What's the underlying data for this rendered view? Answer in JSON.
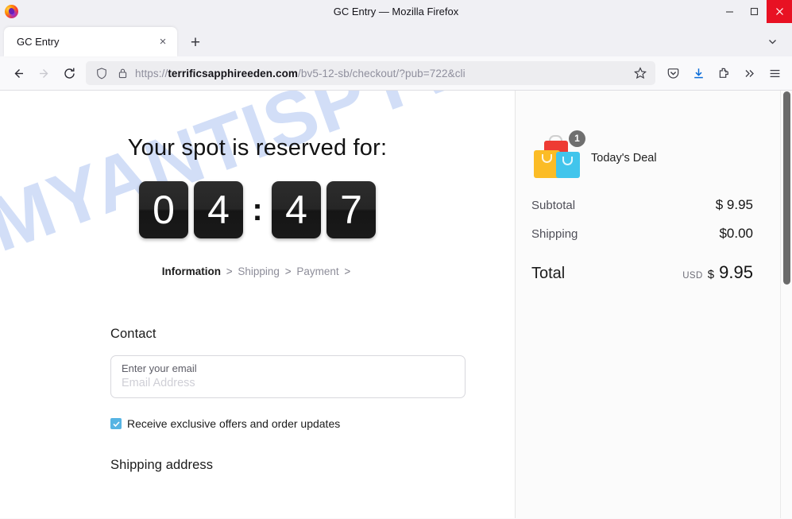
{
  "window": {
    "title": "GC Entry — Mozilla Firefox",
    "logo_icon": "firefox-logo",
    "minimize_label": "Minimize",
    "maximize_label": "Maximize",
    "close_label": "Close"
  },
  "tabs": {
    "items": [
      {
        "title": "GC Entry",
        "close_label": "×"
      }
    ],
    "new_tab_label": "+",
    "list_all_icon": "chevron-down-icon"
  },
  "toolbar": {
    "back_icon": "back-arrow-icon",
    "forward_icon": "forward-arrow-icon",
    "reload_icon": "reload-icon",
    "shield_icon": "shield-icon",
    "lock_icon": "lock-icon",
    "url_prefix": "https://",
    "url_domain": "terrificsapphireeden.com",
    "url_path": "/bv5-12-sb/checkout/?pub=722&cli",
    "bookmark_icon": "star-icon",
    "pocket_icon": "pocket-icon",
    "downloads_icon": "download-icon",
    "extensions_icon": "extensions-puzzle-icon",
    "overflow_icon": "double-chevron-icon",
    "menu_icon": "hamburger-menu-icon"
  },
  "page": {
    "watermark": "MYANTISPYWARE.COM",
    "headline": "Your spot is reserved for:",
    "timer": {
      "digits": [
        "0",
        "4",
        "4",
        "7"
      ],
      "separator": ":",
      "display": "04:47"
    },
    "breadcrumb": {
      "steps": [
        {
          "label": "Information",
          "active": true
        },
        {
          "label": "Shipping",
          "active": false
        },
        {
          "label": "Payment",
          "active": false
        }
      ],
      "separator": ">"
    },
    "contact": {
      "section_title": "Contact",
      "email_label": "Enter your email",
      "email_placeholder": "Email Address",
      "email_value": "",
      "optin_label": "Receive exclusive offers and order updates",
      "optin_checked": true
    },
    "shipping": {
      "section_title": "Shipping address"
    }
  },
  "summary": {
    "item": {
      "name": "Today's Deal",
      "quantity_badge": "1",
      "icon": "shopping-bags-icon"
    },
    "rows": [
      {
        "label": "Subtotal",
        "sign": "$",
        "amount": "9.95",
        "spaced": true
      },
      {
        "label": "Shipping",
        "sign": "$",
        "amount": "0.00",
        "spaced": false
      }
    ],
    "subtotal_label": "Subtotal",
    "subtotal_value": "$ 9.95",
    "shipping_label": "Shipping",
    "shipping_value": "$0.00",
    "total_label": "Total",
    "total_currency": "USD",
    "total_sign": "$",
    "total_amount": "9.95"
  },
  "colors": {
    "accent_blue": "#0a6cd8",
    "checkbox_blue": "#56b4e3",
    "close_red": "#e81123",
    "bag_red": "#ee3b33",
    "bag_yellow": "#fbbc26",
    "bag_cyan": "#41c5ec",
    "watermark_blue": "#c3d4f5",
    "tile_dark": "#1a1a1a"
  }
}
